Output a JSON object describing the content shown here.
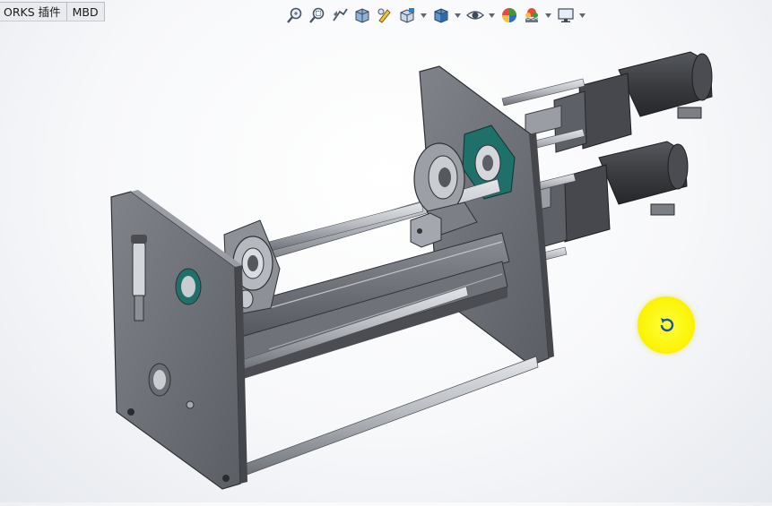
{
  "tabs": [
    {
      "label": "ORKS 插件"
    },
    {
      "label": "MBD"
    }
  ],
  "heads_up_toolbar": {
    "tools": [
      {
        "icon": "zoom-to-fit-icon",
        "dropdown": false
      },
      {
        "icon": "zoom-to-area-icon",
        "dropdown": false
      },
      {
        "icon": "previous-view-icon",
        "dropdown": false
      },
      {
        "icon": "section-view-icon",
        "dropdown": false
      },
      {
        "icon": "dynamic-annotation-views-icon",
        "dropdown": false
      },
      {
        "icon": "view-orientation-icon",
        "dropdown": true
      },
      {
        "icon": "display-style-icon",
        "dropdown": true
      },
      {
        "icon": "hide-show-items-icon",
        "dropdown": true
      },
      {
        "icon": "edit-appearance-icon",
        "dropdown": false
      },
      {
        "icon": "apply-scene-icon",
        "dropdown": true
      },
      {
        "icon": "view-settings-icon",
        "dropdown": true
      }
    ]
  },
  "model": {
    "description_icon": "3d-assembly-model",
    "colors": {
      "plate": "#6e7076",
      "plate_edge": "#3b3d42",
      "rod": "#b9bcc2",
      "motor": "#3c3e42",
      "bearing_green": "#1f6f6a"
    }
  },
  "cursor": {
    "icon": "rotate-view-cursor-icon",
    "highlight_color": "#fbf200"
  }
}
